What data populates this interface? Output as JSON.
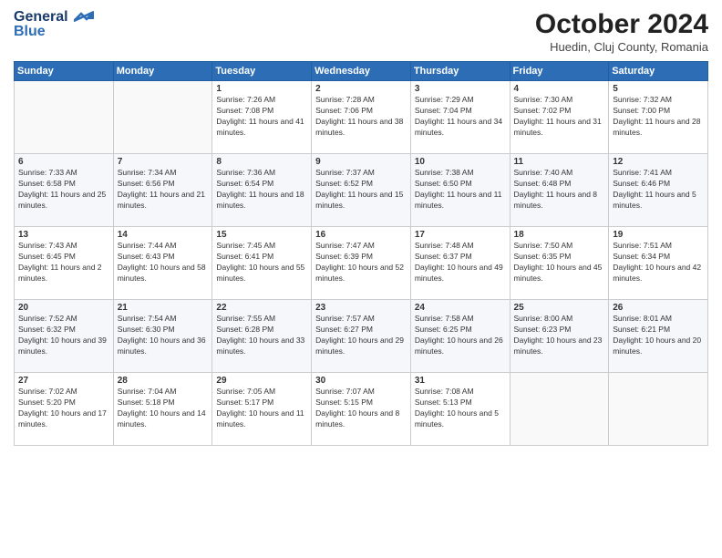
{
  "logo": {
    "line1": "General",
    "line2": "Blue"
  },
  "title": "October 2024",
  "subtitle": "Huedin, Cluj County, Romania",
  "days": [
    "Sunday",
    "Monday",
    "Tuesday",
    "Wednesday",
    "Thursday",
    "Friday",
    "Saturday"
  ],
  "weeks": [
    [
      {
        "day": "",
        "content": ""
      },
      {
        "day": "",
        "content": ""
      },
      {
        "day": "1",
        "content": "Sunrise: 7:26 AM\nSunset: 7:08 PM\nDaylight: 11 hours and 41 minutes."
      },
      {
        "day": "2",
        "content": "Sunrise: 7:28 AM\nSunset: 7:06 PM\nDaylight: 11 hours and 38 minutes."
      },
      {
        "day": "3",
        "content": "Sunrise: 7:29 AM\nSunset: 7:04 PM\nDaylight: 11 hours and 34 minutes."
      },
      {
        "day": "4",
        "content": "Sunrise: 7:30 AM\nSunset: 7:02 PM\nDaylight: 11 hours and 31 minutes."
      },
      {
        "day": "5",
        "content": "Sunrise: 7:32 AM\nSunset: 7:00 PM\nDaylight: 11 hours and 28 minutes."
      }
    ],
    [
      {
        "day": "6",
        "content": "Sunrise: 7:33 AM\nSunset: 6:58 PM\nDaylight: 11 hours and 25 minutes."
      },
      {
        "day": "7",
        "content": "Sunrise: 7:34 AM\nSunset: 6:56 PM\nDaylight: 11 hours and 21 minutes."
      },
      {
        "day": "8",
        "content": "Sunrise: 7:36 AM\nSunset: 6:54 PM\nDaylight: 11 hours and 18 minutes."
      },
      {
        "day": "9",
        "content": "Sunrise: 7:37 AM\nSunset: 6:52 PM\nDaylight: 11 hours and 15 minutes."
      },
      {
        "day": "10",
        "content": "Sunrise: 7:38 AM\nSunset: 6:50 PM\nDaylight: 11 hours and 11 minutes."
      },
      {
        "day": "11",
        "content": "Sunrise: 7:40 AM\nSunset: 6:48 PM\nDaylight: 11 hours and 8 minutes."
      },
      {
        "day": "12",
        "content": "Sunrise: 7:41 AM\nSunset: 6:46 PM\nDaylight: 11 hours and 5 minutes."
      }
    ],
    [
      {
        "day": "13",
        "content": "Sunrise: 7:43 AM\nSunset: 6:45 PM\nDaylight: 11 hours and 2 minutes."
      },
      {
        "day": "14",
        "content": "Sunrise: 7:44 AM\nSunset: 6:43 PM\nDaylight: 10 hours and 58 minutes."
      },
      {
        "day": "15",
        "content": "Sunrise: 7:45 AM\nSunset: 6:41 PM\nDaylight: 10 hours and 55 minutes."
      },
      {
        "day": "16",
        "content": "Sunrise: 7:47 AM\nSunset: 6:39 PM\nDaylight: 10 hours and 52 minutes."
      },
      {
        "day": "17",
        "content": "Sunrise: 7:48 AM\nSunset: 6:37 PM\nDaylight: 10 hours and 49 minutes."
      },
      {
        "day": "18",
        "content": "Sunrise: 7:50 AM\nSunset: 6:35 PM\nDaylight: 10 hours and 45 minutes."
      },
      {
        "day": "19",
        "content": "Sunrise: 7:51 AM\nSunset: 6:34 PM\nDaylight: 10 hours and 42 minutes."
      }
    ],
    [
      {
        "day": "20",
        "content": "Sunrise: 7:52 AM\nSunset: 6:32 PM\nDaylight: 10 hours and 39 minutes."
      },
      {
        "day": "21",
        "content": "Sunrise: 7:54 AM\nSunset: 6:30 PM\nDaylight: 10 hours and 36 minutes."
      },
      {
        "day": "22",
        "content": "Sunrise: 7:55 AM\nSunset: 6:28 PM\nDaylight: 10 hours and 33 minutes."
      },
      {
        "day": "23",
        "content": "Sunrise: 7:57 AM\nSunset: 6:27 PM\nDaylight: 10 hours and 29 minutes."
      },
      {
        "day": "24",
        "content": "Sunrise: 7:58 AM\nSunset: 6:25 PM\nDaylight: 10 hours and 26 minutes."
      },
      {
        "day": "25",
        "content": "Sunrise: 8:00 AM\nSunset: 6:23 PM\nDaylight: 10 hours and 23 minutes."
      },
      {
        "day": "26",
        "content": "Sunrise: 8:01 AM\nSunset: 6:21 PM\nDaylight: 10 hours and 20 minutes."
      }
    ],
    [
      {
        "day": "27",
        "content": "Sunrise: 7:02 AM\nSunset: 5:20 PM\nDaylight: 10 hours and 17 minutes."
      },
      {
        "day": "28",
        "content": "Sunrise: 7:04 AM\nSunset: 5:18 PM\nDaylight: 10 hours and 14 minutes."
      },
      {
        "day": "29",
        "content": "Sunrise: 7:05 AM\nSunset: 5:17 PM\nDaylight: 10 hours and 11 minutes."
      },
      {
        "day": "30",
        "content": "Sunrise: 7:07 AM\nSunset: 5:15 PM\nDaylight: 10 hours and 8 minutes."
      },
      {
        "day": "31",
        "content": "Sunrise: 7:08 AM\nSunset: 5:13 PM\nDaylight: 10 hours and 5 minutes."
      },
      {
        "day": "",
        "content": ""
      },
      {
        "day": "",
        "content": ""
      }
    ]
  ]
}
